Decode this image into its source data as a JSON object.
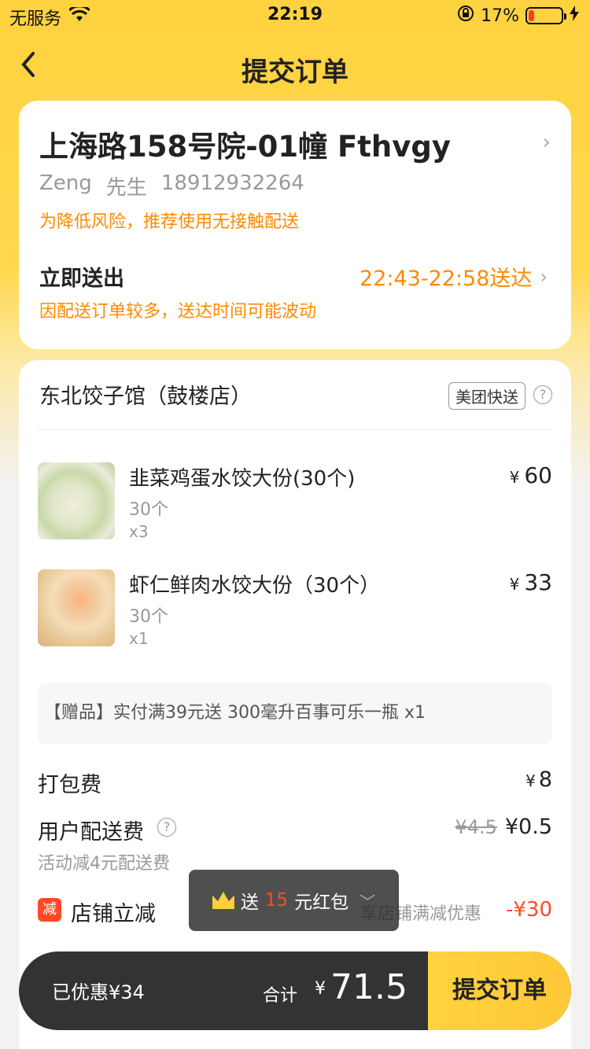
{
  "status_bar": {
    "carrier": "无服务",
    "time": "22:19",
    "battery_percent": "17%",
    "battery_level": 0.17,
    "battery_color": "#ff3b30"
  },
  "nav": {
    "back_icon": "chevron-left-icon",
    "title": "提交订单"
  },
  "address": {
    "line": "上海路158号院-01幢 Fthvgy",
    "name": "Zeng",
    "title": "先生",
    "phone": "18912932264",
    "risk_tip": "为降低风险，推荐使用无接触配送",
    "deliver_label": "立即送出",
    "deliver_time": "22:43-22:58送达",
    "deliver_tip": "因配送订单较多，送达时间可能波动"
  },
  "shop": {
    "name": "东北饺子馆（鼓楼店）",
    "delivery_tag": "美团快送",
    "help_icon": "?"
  },
  "items": [
    {
      "name": "韭菜鸡蛋水饺大份(30个)",
      "spec": "30个",
      "qty": "x3",
      "currency": "¥",
      "price": "60"
    },
    {
      "name": "虾仁鲜肉水饺大份（30个）",
      "spec": "30个",
      "qty": "x1",
      "currency": "¥",
      "price": "33"
    }
  ],
  "gift": "【赠品】实付满39元送 300毫升百事可乐一瓶 x1",
  "fees": {
    "packing_label": "打包费",
    "packing_currency": "¥",
    "packing_value": "8",
    "delivery_label": "用户配送费",
    "delivery_help": "?",
    "delivery_old": "¥4.5",
    "delivery_value": "¥0.5",
    "delivery_sub": "活动减4元配送费",
    "reduce_badge": "减",
    "reduce_label": "店铺立减",
    "reduce_desc": "享店铺满减优惠",
    "reduce_value": "-¥30"
  },
  "toast": {
    "prefix": "送",
    "amount": "15",
    "suffix": "元红包",
    "chevron": "﹀"
  },
  "bottom": {
    "saved": "已优惠¥34",
    "total_label": "合计",
    "currency": "¥",
    "total": "71.5",
    "submit": "提交订单"
  },
  "colors": {
    "brand_yellow": "#ffd23f",
    "accent_orange": "#ff8a00",
    "discount_red": "#ff4a26"
  }
}
